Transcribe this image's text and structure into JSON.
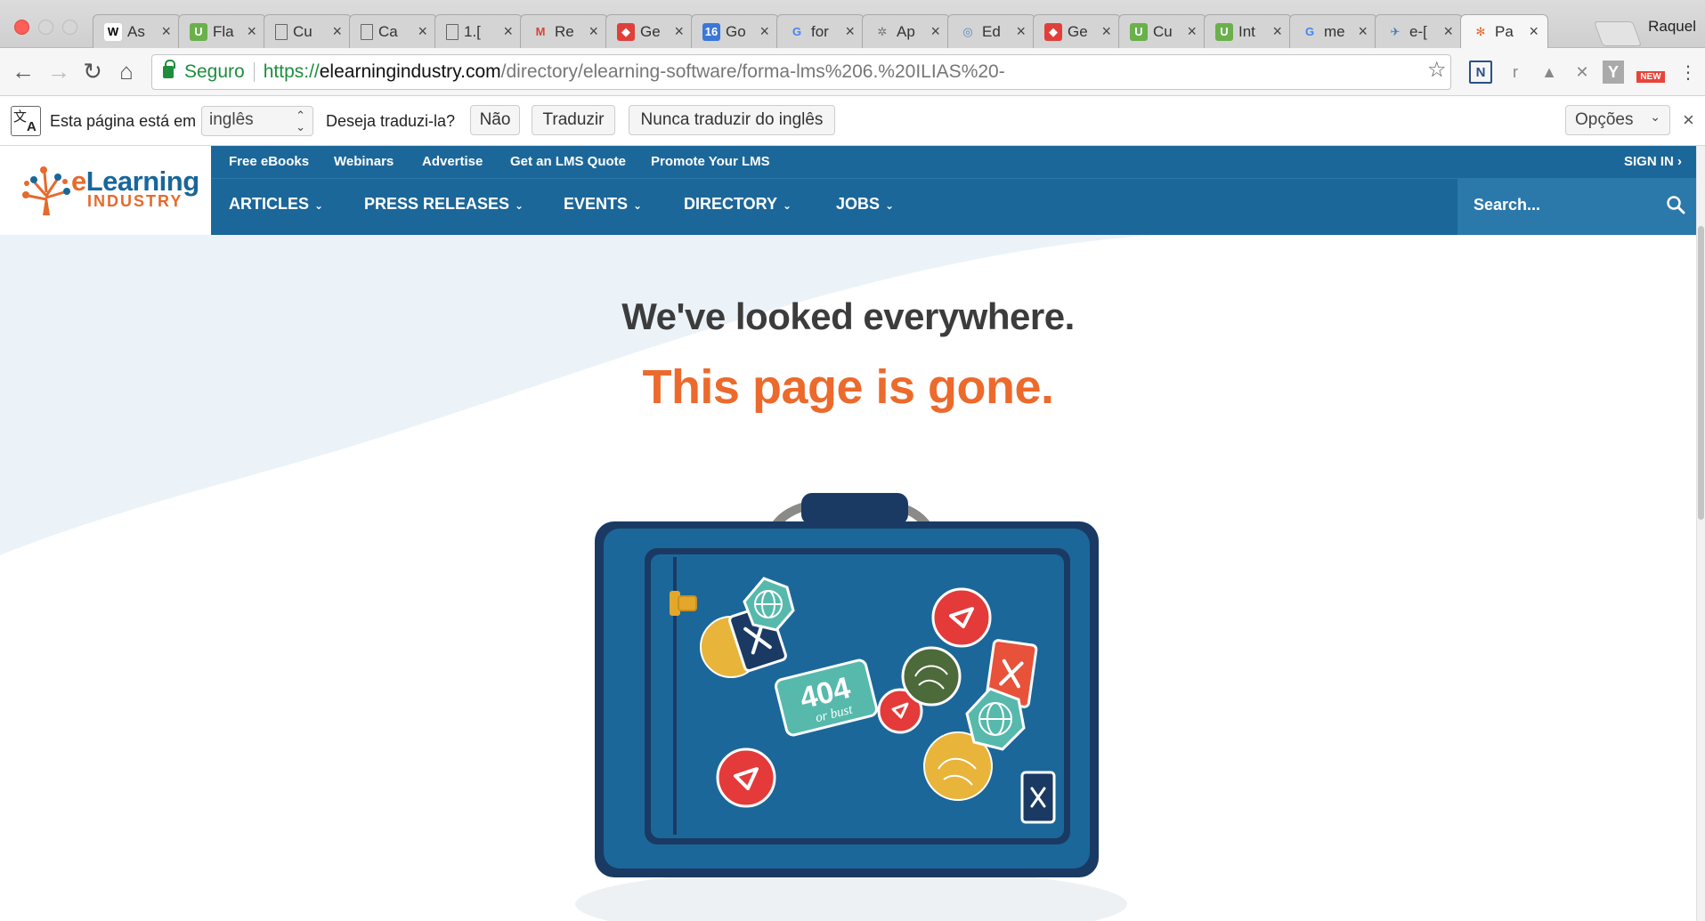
{
  "browser": {
    "tabs": [
      {
        "label": "As",
        "favicon": "wikipedia-icon",
        "favicon_text": "W",
        "favicon_bg": "#ffffff",
        "favicon_color": "#000000"
      },
      {
        "label": "Fla",
        "favicon": "u-green-icon",
        "favicon_text": "U",
        "favicon_bg": "#6ab04c",
        "favicon_color": "#ffffff"
      },
      {
        "label": "Cu",
        "favicon": "document-icon",
        "favicon_text": "",
        "favicon_bg": "transparent",
        "favicon_color": "#555555"
      },
      {
        "label": "Ca",
        "favicon": "document-icon",
        "favicon_text": "",
        "favicon_bg": "transparent",
        "favicon_color": "#555555"
      },
      {
        "label": "1.[",
        "favicon": "document-icon",
        "favicon_text": "",
        "favicon_bg": "transparent",
        "favicon_color": "#555555"
      },
      {
        "label": "Re",
        "favicon": "gmail-icon",
        "favicon_text": "M",
        "favicon_bg": "transparent",
        "favicon_color": "#d44638"
      },
      {
        "label": "Ge",
        "favicon": "speech-bubble-icon",
        "favicon_text": "◆",
        "favicon_bg": "#e0403a",
        "favicon_color": "#ffffff"
      },
      {
        "label": "Go",
        "favicon": "calendar-icon",
        "favicon_text": "16",
        "favicon_bg": "#3b77d8",
        "favicon_color": "#ffffff"
      },
      {
        "label": "for",
        "favicon": "google-icon",
        "favicon_text": "G",
        "favicon_bg": "transparent",
        "favicon_color": "#4285f4"
      },
      {
        "label": "Ap",
        "favicon": "tree-icon",
        "favicon_text": "✲",
        "favicon_bg": "transparent",
        "favicon_color": "#777777"
      },
      {
        "label": "Ed",
        "favicon": "swirl-icon",
        "favicon_text": "◎",
        "favicon_bg": "transparent",
        "favicon_color": "#5a88b8"
      },
      {
        "label": "Ge",
        "favicon": "speech-bubble-icon",
        "favicon_text": "◆",
        "favicon_bg": "#e0403a",
        "favicon_color": "#ffffff"
      },
      {
        "label": "Cu",
        "favicon": "u-green-icon",
        "favicon_text": "U",
        "favicon_bg": "#6ab04c",
        "favicon_color": "#ffffff"
      },
      {
        "label": "Int",
        "favicon": "u-green-icon",
        "favicon_text": "U",
        "favicon_bg": "#6ab04c",
        "favicon_color": "#ffffff"
      },
      {
        "label": "me",
        "favicon": "google-icon",
        "favicon_text": "G",
        "favicon_bg": "transparent",
        "favicon_color": "#4285f4"
      },
      {
        "label": "e-[",
        "favicon": "bird-icon",
        "favicon_text": "✈",
        "favicon_bg": "transparent",
        "favicon_color": "#3c7dbf"
      },
      {
        "label": "Pa",
        "favicon": "elearning-icon",
        "favicon_text": "✻",
        "favicon_bg": "transparent",
        "favicon_color": "#e66a2c",
        "active": true
      }
    ],
    "profile_name": "Raquel",
    "security_label": "Seguro",
    "url_scheme": "https://",
    "url_domain": "elearningindustry.com",
    "url_path": "/directory/elearning-software/forma-lms%206.%20ILIAS%20-"
  },
  "translate_bar": {
    "prefix": "Esta página está em",
    "language": "inglês",
    "question": "Deseja traduzi-la?",
    "no_button": "Não",
    "translate_button": "Traduzir",
    "never_button": "Nunca traduzir do inglês",
    "options_label": "Opções"
  },
  "site": {
    "logo_line1_a": "e",
    "logo_line1_b": "Learning",
    "logo_line2": "INDUSTRY",
    "top_links": [
      "Free eBooks",
      "Webinars",
      "Advertise",
      "Get an LMS Quote",
      "Promote Your LMS"
    ],
    "sign_in": "SIGN IN ›",
    "main_nav": [
      "ARTICLES",
      "PRESS RELEASES",
      "EVENTS",
      "DIRECTORY",
      "JOBS"
    ],
    "search_placeholder": "Search...",
    "brand_blue": "#1c6799",
    "brand_orange": "#ec6a2c"
  },
  "error_page": {
    "headline": "We've looked everywhere.",
    "subheadline": "This page is gone.",
    "sticker_text_1": "404",
    "sticker_text_2": "or bust"
  }
}
